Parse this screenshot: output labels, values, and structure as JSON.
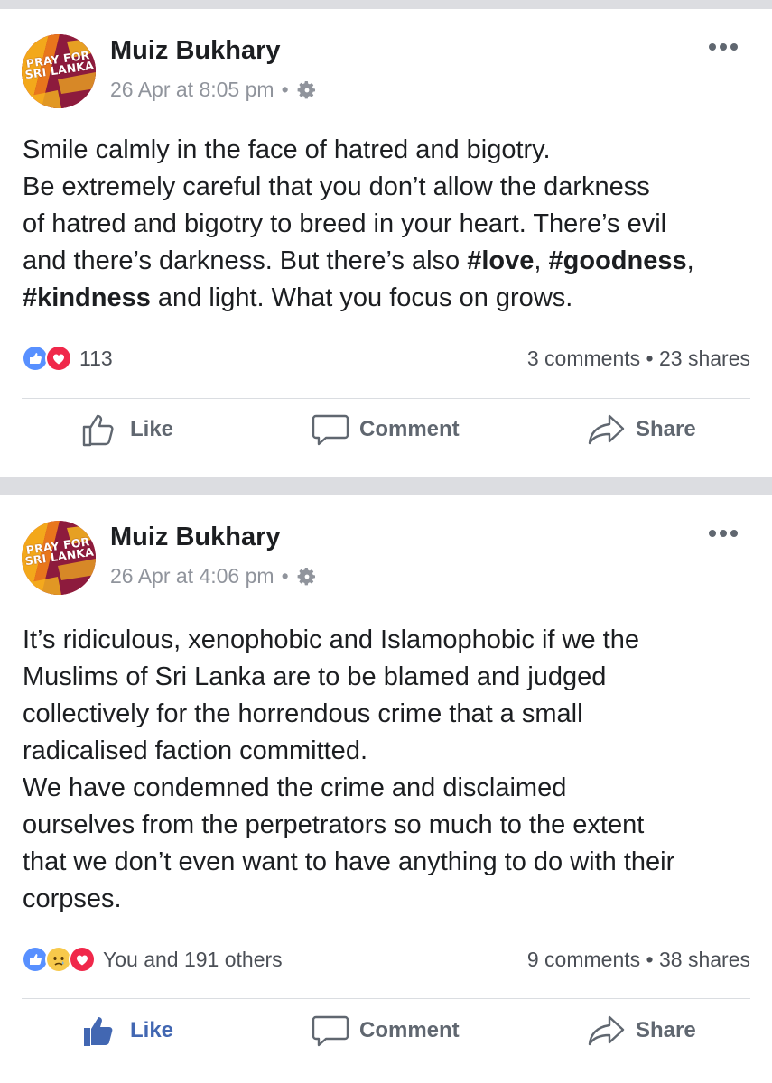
{
  "posts": [
    {
      "author": "Muiz Bukhary",
      "avatar_text": [
        "PRAY FOR",
        "SRI LANKA"
      ],
      "timestamp": "26 Apr at 8:05 pm",
      "separator": "•",
      "privacy_icon": "gear-icon",
      "more_icon": "more-dots-icon",
      "body_lines": [
        [
          {
            "t": "Smile calmly in the face of hatred and bigotry."
          }
        ],
        [
          {
            "t": "Be extremely careful that you don’t allow the darkness"
          }
        ],
        [
          {
            "t": "of hatred and bigotry to breed in your heart. There’s evil"
          }
        ],
        [
          {
            "t": "and there’s darkness. But there’s also "
          },
          {
            "t": "#love",
            "b": true
          },
          {
            "t": ", "
          },
          {
            "t": "#goodness",
            "b": true
          },
          {
            "t": ","
          }
        ],
        [
          {
            "t": "#kindness",
            "b": true
          },
          {
            "t": " and light. What you focus on grows."
          }
        ]
      ],
      "reactions": [
        "like",
        "love"
      ],
      "reaction_count": "113",
      "comments": "3 comments",
      "stats_separator": "•",
      "shares": "23 shares",
      "actions": {
        "like": "Like",
        "comment": "Comment",
        "share": "Share"
      },
      "liked": false
    },
    {
      "author": "Muiz Bukhary",
      "avatar_text": [
        "PRAY FOR",
        "SRI LANKA"
      ],
      "timestamp": "26 Apr at 4:06 pm",
      "separator": "•",
      "privacy_icon": "gear-icon",
      "more_icon": "more-dots-icon",
      "body_lines": [
        [
          {
            "t": "It’s ridiculous, xenophobic and Islamophobic if we the"
          }
        ],
        [
          {
            "t": "Muslims of Sri Lanka are to be blamed and judged"
          }
        ],
        [
          {
            "t": "collectively for the horrendous crime that a small"
          }
        ],
        [
          {
            "t": "radicalised faction committed."
          }
        ],
        [
          {
            "t": "We have condemned the crime and disclaimed"
          }
        ],
        [
          {
            "t": "ourselves from the perpetrators so much to the extent"
          }
        ],
        [
          {
            "t": "that we don’t even want to have anything to do with their"
          }
        ],
        [
          {
            "t": "corpses."
          }
        ]
      ],
      "reactions": [
        "like",
        "sad",
        "love"
      ],
      "reaction_count": "You and 191 others",
      "comments": "9 comments",
      "stats_separator": "•",
      "shares": "38 shares",
      "actions": {
        "like": "Like",
        "comment": "Comment",
        "share": "Share"
      },
      "liked": true
    }
  ],
  "colors": {
    "like_blue": "#4267b2",
    "reaction_like": "#5890ff",
    "reaction_love": "#f0284a",
    "reaction_sad": "#f7c94b",
    "muted_text": "#90949c",
    "page_bg": "#dcdde1"
  }
}
